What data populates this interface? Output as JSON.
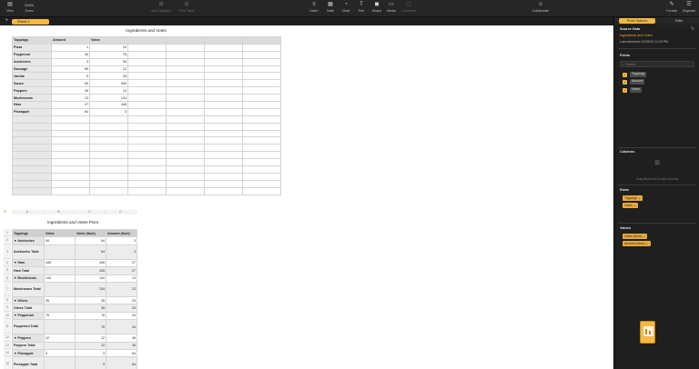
{
  "toolbar": {
    "view_label": "View",
    "zoom_label": "Zoom",
    "zoom_value": "124%",
    "add_category_label": "Add Category",
    "pivot_table_label": "Pivot Table",
    "insert_label": "Insert",
    "table_label": "Table",
    "chart_label": "Chart",
    "text_label": "Text",
    "shape_label": "Shape",
    "media_label": "Media",
    "comment_label": "Comment",
    "collaborate_label": "Collaborate",
    "format_label": "Format",
    "organize_label": "Organize"
  },
  "sheet_tabs": {
    "add_icon": "plus",
    "active": "Sheet 1"
  },
  "table": {
    "title": "Ingredients and Votes",
    "headers": [
      "Toppings",
      "Amount",
      "Votes"
    ],
    "rows": [
      [
        "Pizza",
        "1",
        "10"
      ],
      [
        "Pepperoni",
        "34",
        "76"
      ],
      [
        "Anchovies",
        "3",
        "54"
      ],
      [
        "Sausage",
        "65",
        "12"
      ],
      [
        "Vanilla",
        "0",
        "34"
      ],
      [
        "Sauce",
        "50",
        "900"
      ],
      [
        "Peppers",
        "45",
        "12"
      ],
      [
        "Mushrooms",
        "13",
        "134"
      ],
      [
        "Ham",
        "27",
        "445"
      ],
      [
        "Pineapple",
        "64",
        "3"
      ]
    ],
    "blank_rows": 11
  },
  "pivot": {
    "title": "Ingredients and Votes Pivot",
    "column_headers": [
      "A",
      "B",
      "C",
      "D"
    ],
    "headers": [
      "Toppings",
      "Votes",
      "Votes (Sum)",
      "Amount (Sum)"
    ],
    "rows": [
      {
        "n": "1",
        "a": "Toppings",
        "b": "Votes",
        "c": "Votes (Sum)",
        "d": "Amount (Sum)",
        "kind": "h"
      },
      {
        "n": "2",
        "a": "▼  Anchovies",
        "b": "54",
        "c": "54",
        "d": "3",
        "kind": "g"
      },
      {
        "n": "3",
        "a": "Anchovies Total",
        "b": "",
        "c": "54",
        "d": "3",
        "kind": "t"
      },
      {
        "n": "4",
        "a": "▼  Ham",
        "b": "445",
        "c": "445",
        "d": "27",
        "kind": "g"
      },
      {
        "n": "5",
        "a": "Ham Total",
        "b": "",
        "c": "445",
        "d": "27",
        "kind": "t"
      },
      {
        "n": "6",
        "a": "▼  Mushrooms",
        "b": "134",
        "c": "134",
        "d": "13",
        "kind": "g"
      },
      {
        "n": "7",
        "a": "Mushrooms Total",
        "b": "",
        "c": "134",
        "d": "13",
        "kind": "t"
      },
      {
        "n": "8",
        "a": "▼  Olives",
        "b": "35",
        "c": "35",
        "d": "23",
        "kind": "g"
      },
      {
        "n": "9",
        "a": "Olives Total",
        "b": "",
        "c": "35",
        "d": "23",
        "kind": "t"
      },
      {
        "n": "10",
        "a": "▼  Pepperoni",
        "b": "76",
        "c": "76",
        "d": "34",
        "kind": "g"
      },
      {
        "n": "11",
        "a": "Pepperoni Total",
        "b": "",
        "c": "76",
        "d": "34",
        "kind": "t"
      },
      {
        "n": "12",
        "a": "▼  Peppers",
        "b": "12",
        "c": "12",
        "d": "45",
        "kind": "g"
      },
      {
        "n": "13",
        "a": "Peppers Total",
        "b": "",
        "c": "12",
        "d": "45",
        "kind": "t"
      },
      {
        "n": "14",
        "a": "▼  Pineapple",
        "b": "3",
        "c": "3",
        "d": "64",
        "kind": "g"
      },
      {
        "n": "15",
        "a": "Pineapple Total",
        "b": "",
        "c": "3",
        "d": "64",
        "kind": "t"
      }
    ]
  },
  "sidebar": {
    "tab_pivot": "Pivot Options",
    "tab_filter": "Filter",
    "source_title": "Source Data",
    "source_name": "Ingredients and Votes",
    "last_refreshed": "Last refreshed: 10/15/23, 11:23 PM",
    "fields_title": "Fields",
    "search_placeholder": "Search",
    "fields": [
      "Toppings",
      "Amount",
      "Votes"
    ],
    "columns_title": "Columns",
    "columns_drop_hint": "Drag fields here to add columns",
    "rows_title": "Rows",
    "rows_items": [
      "Toppings",
      "Votes"
    ],
    "values_title": "Values",
    "values_items": [
      "Votes (Sum)",
      "Amount (Sum)"
    ],
    "accent_color": "#f5b841"
  }
}
